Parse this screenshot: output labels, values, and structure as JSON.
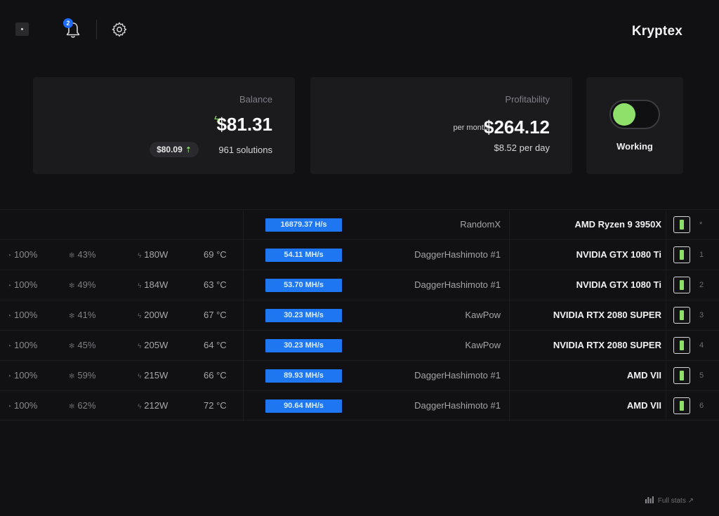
{
  "header": {
    "brand": "Kryptex",
    "notification_count": "2",
    "icons": {
      "settings": "gear-icon",
      "notifications": "bell-icon",
      "window": "window-button"
    }
  },
  "balance": {
    "label": "Balance",
    "value": "$81.31",
    "solutions": "961 solutions",
    "change": "$80.09"
  },
  "profitability": {
    "label": "Profitability",
    "monthly": "$264.12",
    "monthly_unit": "per month",
    "daily": "$8.52 per day"
  },
  "status": {
    "label": "Working",
    "on": true
  },
  "devices": [
    {
      "index": "*",
      "name": "AMD Ryzen 9 3950X",
      "algorithm": "RandomX",
      "hashrate": "16879.37 H/s",
      "temperature": "",
      "power": "",
      "fan": "",
      "load": ""
    },
    {
      "index": "1",
      "name": "NVIDIA GTX 1080 Ti",
      "algorithm": "DaggerHashimoto #1",
      "hashrate": "54.11 MH/s",
      "temperature": "69 °C",
      "power": "180W",
      "fan": "43%",
      "load": "100%"
    },
    {
      "index": "2",
      "name": "NVIDIA GTX 1080 Ti",
      "algorithm": "DaggerHashimoto #1",
      "hashrate": "53.70 MH/s",
      "temperature": "63 °C",
      "power": "184W",
      "fan": "49%",
      "load": "100%"
    },
    {
      "index": "3",
      "name": "NVIDIA RTX 2080 SUPER",
      "algorithm": "KawPow",
      "hashrate": "30.23 MH/s",
      "temperature": "67 °C",
      "power": "200W",
      "fan": "41%",
      "load": "100%"
    },
    {
      "index": "4",
      "name": "NVIDIA RTX 2080 SUPER",
      "algorithm": "KawPow",
      "hashrate": "30.23 MH/s",
      "temperature": "64 °C",
      "power": "205W",
      "fan": "45%",
      "load": "100%"
    },
    {
      "index": "5",
      "name": "AMD VII",
      "algorithm": "DaggerHashimoto #1",
      "hashrate": "89.93 MH/s",
      "temperature": "66 °C",
      "power": "215W",
      "fan": "59%",
      "load": "100%"
    },
    {
      "index": "6",
      "name": "AMD VII",
      "algorithm": "DaggerHashimoto #1",
      "hashrate": "90.64 MH/s",
      "temperature": "72 °C",
      "power": "212W",
      "fan": "62%",
      "load": "100%"
    }
  ],
  "footer": {
    "full_stats": "Full stats"
  },
  "colors": {
    "accent_blue": "#1e76f0",
    "accent_green": "#8ee06a",
    "background": "#111113",
    "card": "#1b1b1e"
  }
}
